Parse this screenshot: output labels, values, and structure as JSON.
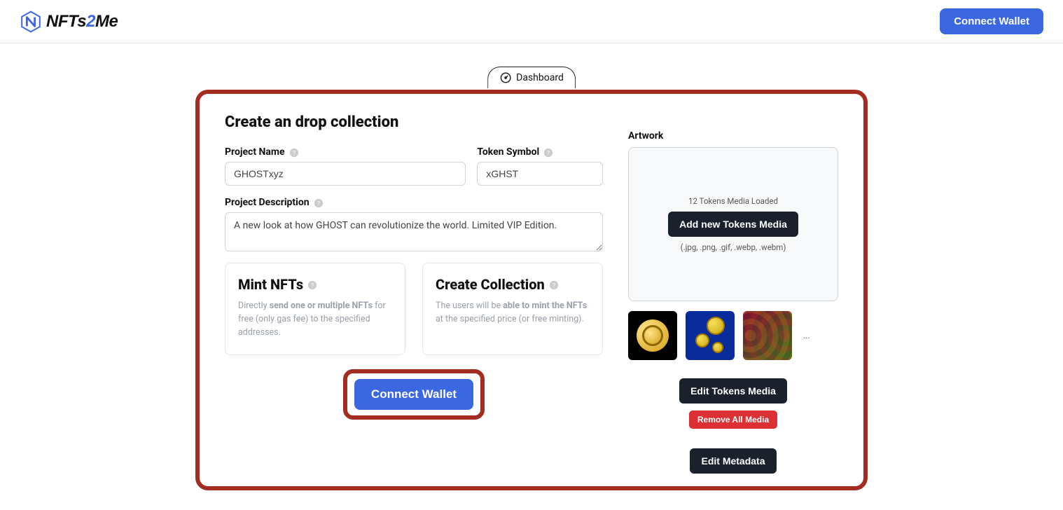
{
  "header": {
    "brand_pre": "NFTs",
    "brand_mid": "2",
    "brand_post": "Me",
    "connect_label": "Connect Wallet"
  },
  "tab": {
    "dashboard": "Dashboard"
  },
  "form": {
    "title": "Create an drop collection",
    "project_name_label": "Project Name",
    "project_name_value": "GHOSTxyz",
    "token_symbol_label": "Token Symbol",
    "token_symbol_value": "xGHST",
    "project_desc_label": "Project Description",
    "project_desc_value": "A new look at how GHOST can revolutionize the world. Limited VIP Edition."
  },
  "options": {
    "mint_title": "Mint NFTs",
    "mint_pre": "Directly ",
    "mint_bold": "send one or multiple NFTs",
    "mint_post": " for free (only gas fee) to the specified addresses.",
    "create_title": "Create Collection",
    "create_pre": "The users will be ",
    "create_bold": "able to mint the NFTs",
    "create_post": " at the specified price (or free minting)."
  },
  "connect": {
    "label": "Connect Wallet"
  },
  "artwork": {
    "label": "Artwork",
    "loaded": "12 Tokens Media Loaded",
    "add_button": "Add new Tokens Media",
    "hint": "(.jpg, .png, .gif, .webp, .webm)",
    "ellipsis": "...",
    "edit_tokens": "Edit Tokens Media",
    "remove_all": "Remove All Media",
    "edit_metadata": "Edit Metadata"
  }
}
